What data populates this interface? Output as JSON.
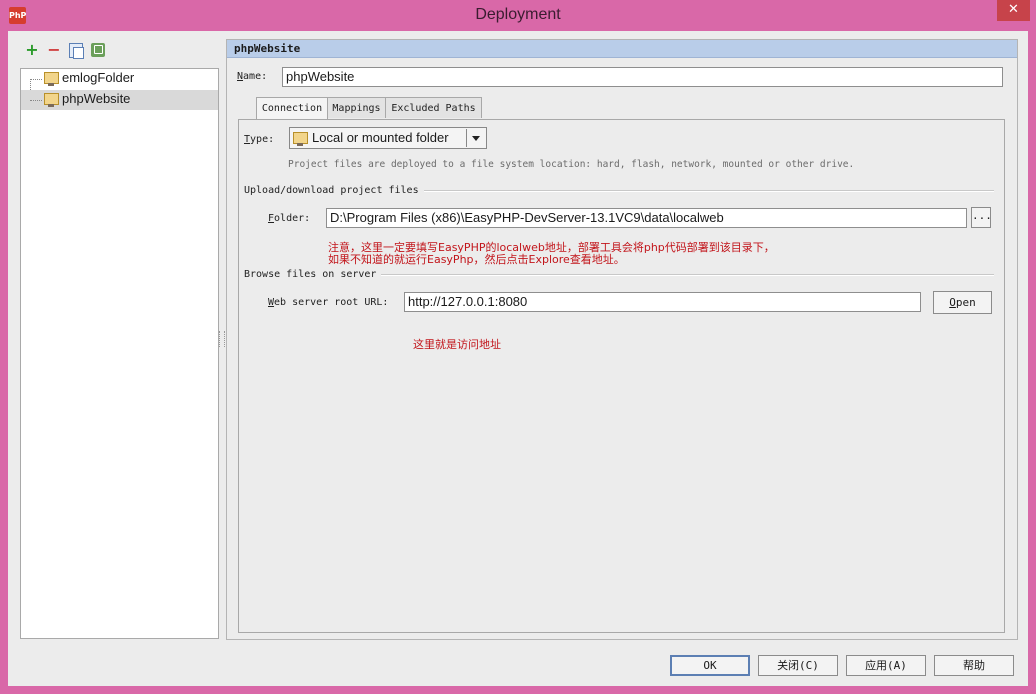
{
  "window": {
    "title": "Deployment",
    "close_glyph": "✕",
    "app_icon_text": "PhP"
  },
  "toolbar": {
    "add": "+",
    "remove": "−"
  },
  "tree": {
    "items": [
      {
        "label": "emlogFolder"
      },
      {
        "label": "phpWebsite"
      }
    ]
  },
  "panel": {
    "title": "phpWebsite",
    "name_label_u": "N",
    "name_label_rest": "ame:",
    "name_value": "phpWebsite",
    "tabs": [
      "Connection",
      "Mappings",
      "Excluded Paths"
    ],
    "type_label_u": "T",
    "type_label_rest": "ype:",
    "type_value": "Local or mounted folder",
    "type_hint": "Project files are deployed to a file system location: hard, flash, network, mounted or other drive.",
    "section_upload": "Upload/download project files",
    "folder_label_u": "F",
    "folder_label_rest": "older:",
    "folder_value": "D:\\Program Files (x86)\\EasyPHP-DevServer-13.1VC9\\data\\localweb",
    "browse_label": "...",
    "annotation_line1": "注意，这里一定要填写EasyPHP的localweb地址，部署工具会将php代码部署到该目录下，",
    "annotation_line2": "如果不知道的就运行EasyPhp，然后点击Explore查看地址。",
    "section_browse": "Browse files on server",
    "url_label_u": "W",
    "url_label_rest": "eb server root URL:",
    "url_value": "http://127.0.0.1:8080",
    "open_label_u": "O",
    "open_label_rest": "pen",
    "annotation_url": "这里就是访问地址"
  },
  "buttons": {
    "ok": "OK",
    "close": "关闭(C)",
    "apply": "应用(A)",
    "help": "帮助"
  },
  "colors": {
    "frame": "#d968a8",
    "header": "#b9cde9",
    "annotation": "#c2151b"
  }
}
